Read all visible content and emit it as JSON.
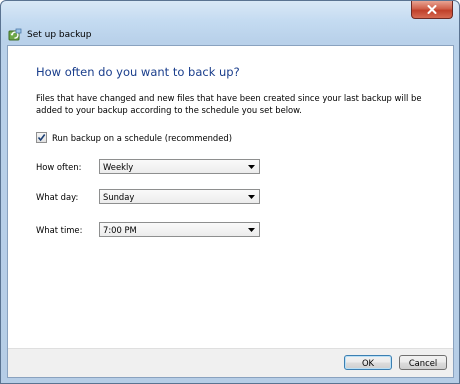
{
  "window": {
    "title": "Set up backup",
    "icons": {
      "app": "backup-icon",
      "close": "close-icon"
    }
  },
  "page": {
    "heading": "How often do you want to back up?",
    "description": "Files that have changed and new files that have been created since your last backup will be added to your backup according to the schedule you set below."
  },
  "schedule": {
    "checkbox_label": "Run backup on a schedule (recommended)",
    "checked": true
  },
  "fields": {
    "how_often": {
      "label": "How often:",
      "value": "Weekly"
    },
    "what_day": {
      "label": "What day:",
      "value": "Sunday"
    },
    "what_time": {
      "label": "What time:",
      "value": "7:00 PM"
    }
  },
  "buttons": {
    "ok": "OK",
    "cancel": "Cancel"
  },
  "colors": {
    "heading": "#1a3e8c",
    "frame": "#b9d1ea",
    "close_button": "#c0402a"
  }
}
